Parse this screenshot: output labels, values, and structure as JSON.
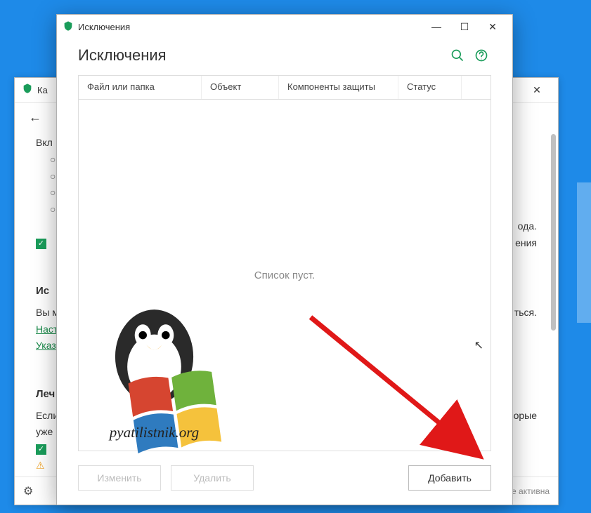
{
  "back_window": {
    "title_prefix": "Ка",
    "content": {
      "line1": "Вкл",
      "bullets": [
        "",
        "",
        "",
        ""
      ],
      "right_frag1": "ода.",
      "right_frag2": "ения",
      "section_excl_prefix": "Ис",
      "line_vy": "Вы м",
      "right_frag3": "ться.",
      "link1": "Наст",
      "link2": "Указ",
      "section_lech_prefix": "Леч",
      "line_esli": "Если",
      "line_uzhe": "уже",
      "right_frag4": "орые"
    },
    "footer_text": "е активна"
  },
  "front_window": {
    "title": "Исключения",
    "heading": "Исключения",
    "columns": {
      "file_or_folder": "Файл или папка",
      "object": "Объект",
      "protection_components": "Компоненты защиты",
      "status": "Статус"
    },
    "empty_message": "Список пуст.",
    "buttons": {
      "edit": "Изменить",
      "delete": "Удалить",
      "add": "Добавить"
    }
  },
  "watermark_text": "pyatilistnik.org"
}
